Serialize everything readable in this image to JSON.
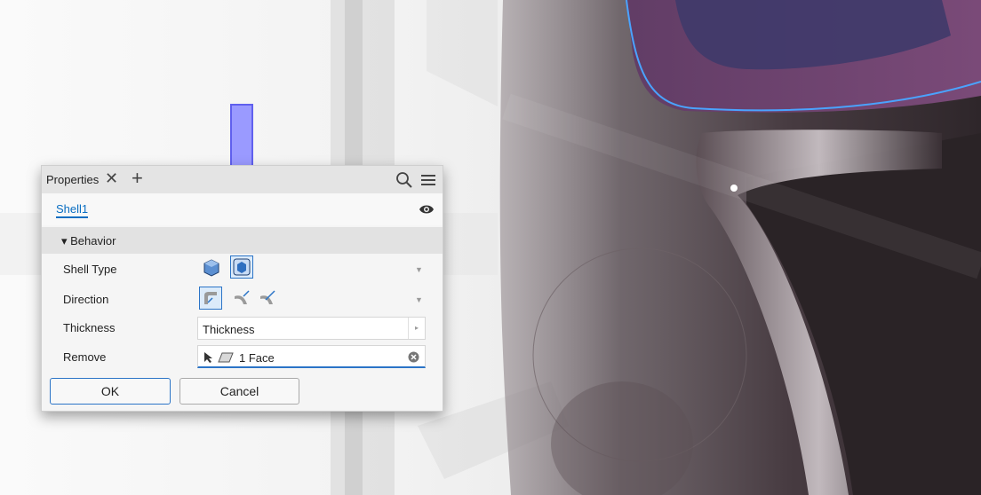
{
  "panel": {
    "tab_title": "Properties",
    "close_glyph": "✕",
    "add_glyph": "+",
    "feature_name": "Shell1",
    "section_label": "▾  Behavior",
    "rows": {
      "shell_type_label": "Shell Type",
      "direction_label": "Direction",
      "thickness_label": "Thickness",
      "remove_label": "Remove"
    },
    "thickness_value": "Thickness",
    "remove_value": "1 Face",
    "ok_label": "OK",
    "cancel_label": "Cancel",
    "dropdown_glyph": "▼",
    "more_glyph": "▸"
  },
  "colors": {
    "accent": "#2b74c7",
    "callout_arrow": "#7b7bff",
    "model_body": "#4a3f44",
    "model_top": "#6b3f6b"
  },
  "icons": [
    "search-icon",
    "menu-icon",
    "eye-icon",
    "shell-inside-icon",
    "shell-outside-icon",
    "direction-inside-icon",
    "direction-outside-icon",
    "direction-both-icon",
    "select-arrow-icon",
    "face-icon",
    "clear-icon"
  ]
}
